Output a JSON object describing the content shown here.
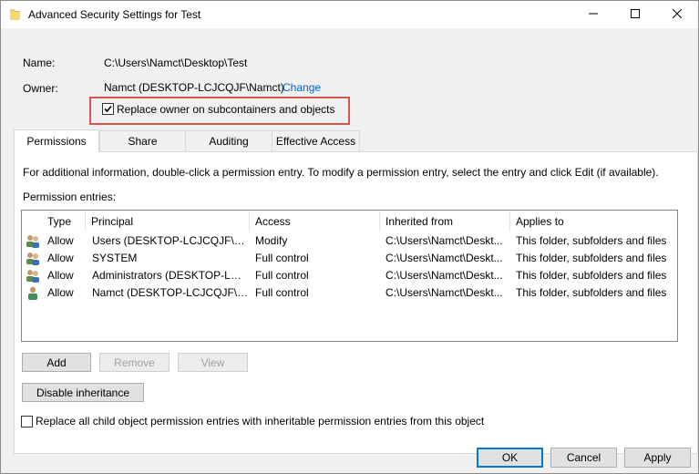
{
  "window": {
    "title": "Advanced Security Settings for Test"
  },
  "info": {
    "name_label": "Name:",
    "name_value": "C:\\Users\\Namct\\Desktop\\Test",
    "owner_label": "Owner:",
    "owner_value": "Namct (DESKTOP-LCJCQJF\\Namct)",
    "change_link": "Change",
    "replace_owner_label": "Replace owner on subcontainers and objects",
    "replace_owner_checked": true
  },
  "tabs": [
    {
      "label": "Permissions",
      "active": true
    },
    {
      "label": "Share",
      "active": false
    },
    {
      "label": "Auditing",
      "active": false
    },
    {
      "label": "Effective Access",
      "active": false
    }
  ],
  "permissions": {
    "info_text": "For additional information, double-click a permission entry. To modify a permission entry, select the entry and click Edit (if available).",
    "entries_label": "Permission entries:",
    "columns": [
      "Type",
      "Principal",
      "Access",
      "Inherited from",
      "Applies to"
    ],
    "rows": [
      {
        "icon": "group-users-icon",
        "type": "Allow",
        "principal": "Users (DESKTOP-LCJCQJF\\Use...",
        "access": "Modify",
        "inherited": "C:\\Users\\Namct\\Deskt...",
        "applies": "This folder, subfolders and files"
      },
      {
        "icon": "group-users-icon",
        "type": "Allow",
        "principal": "SYSTEM",
        "access": "Full control",
        "inherited": "C:\\Users\\Namct\\Deskt...",
        "applies": "This folder, subfolders and files"
      },
      {
        "icon": "group-users-icon",
        "type": "Allow",
        "principal": "Administrators (DESKTOP-LCJ...",
        "access": "Full control",
        "inherited": "C:\\Users\\Namct\\Deskt...",
        "applies": "This folder, subfolders and files"
      },
      {
        "icon": "single-user-icon",
        "type": "Allow",
        "principal": "Namct (DESKTOP-LCJCQJF\\N...",
        "access": "Full control",
        "inherited": "C:\\Users\\Namct\\Deskt...",
        "applies": "This folder, subfolders and files"
      }
    ],
    "add_label": "Add",
    "remove_label": "Remove",
    "view_label": "View",
    "disable_inheritance_label": "Disable inheritance",
    "replace_child_label": "Replace all child object permission entries with inheritable permission entries from this object",
    "replace_child_checked": false
  },
  "footer": {
    "ok_label": "OK",
    "cancel_label": "Cancel",
    "apply_label": "Apply"
  },
  "colors": {
    "highlight_border": "#d9534f",
    "link": "#0066cc",
    "default_button_border": "#0078d7"
  }
}
